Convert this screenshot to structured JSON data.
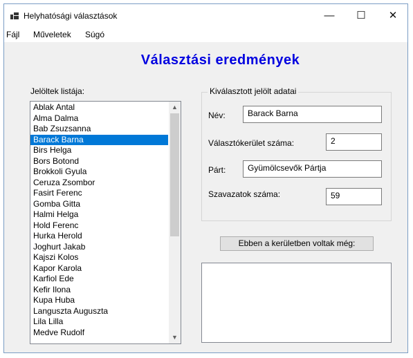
{
  "window": {
    "title": "Helyhatósági választások",
    "minimize_glyph": "—",
    "maximize_glyph": "☐",
    "close_glyph": "✕"
  },
  "menu": {
    "file": "Fájl",
    "operations": "Műveletek",
    "help": "Súgó"
  },
  "heading": "Választási eredmények",
  "candidates": {
    "label": "Jelöltek listája:",
    "items": [
      "Ablak Antal",
      "Alma Dalma",
      "Bab Zsuzsanna",
      "Barack Barna",
      "Birs Helga",
      "Bors Botond",
      "Brokkoli Gyula",
      "Ceruza Zsombor",
      "Fasirt Ferenc",
      "Gomba Gitta",
      "Halmi Helga",
      "Hold Ferenc",
      "Hurka Herold",
      "Joghurt Jakab",
      "Kajszi Kolos",
      "Kapor Karola",
      "Karfiol Ede",
      "Kefir Ilona",
      "Kupa Huba",
      "Languszta Auguszta",
      "Lila Lilla",
      "Medve Rudolf"
    ],
    "selected": "Barack Barna",
    "scroll_up": "▲",
    "scroll_down": "▼"
  },
  "details": {
    "group_title": "Kiválasztott jelölt adatai",
    "name_label": "Név:",
    "name_value": "Barack Barna",
    "district_label": "Választókerület száma:",
    "district_value": "2",
    "party_label": "Párt:",
    "party_value": "Gyümölcsevők Pártja",
    "votes_label": "Szavazatok száma:",
    "votes_value": "59"
  },
  "others_button": "Ebben a kerületben voltak még:",
  "colors": {
    "heading": "#0000e0",
    "selection": "#0078d7"
  }
}
